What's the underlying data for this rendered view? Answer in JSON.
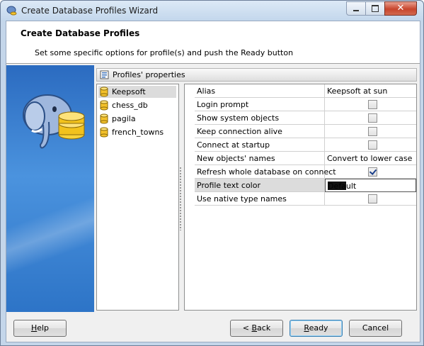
{
  "window": {
    "title": "Create Database Profiles Wizard",
    "controls": {
      "minimize_icon": "minimize-icon",
      "maximize_icon": "maximize-icon",
      "close_icon": "close-icon",
      "close_glyph": "✕"
    }
  },
  "header": {
    "title": "Create Database Profiles",
    "subtitle": "Set some specific options for profile(s) and push the Ready button"
  },
  "group": {
    "title": "Profiles' properties"
  },
  "profiles": [
    {
      "label": "Keepsoft",
      "selected": true
    },
    {
      "label": "chess_db",
      "selected": false
    },
    {
      "label": "pagila",
      "selected": false
    },
    {
      "label": "french_towns",
      "selected": false
    }
  ],
  "properties": [
    {
      "name": "Alias",
      "type": "text",
      "value": "Keepsoft at sun"
    },
    {
      "name": "Login prompt",
      "type": "checkbox",
      "checked": false
    },
    {
      "name": "Show system objects",
      "type": "checkbox",
      "checked": false
    },
    {
      "name": "Keep connection alive",
      "type": "checkbox",
      "checked": false
    },
    {
      "name": "Connect at startup",
      "type": "checkbox",
      "checked": false
    },
    {
      "name": "New objects' names",
      "type": "text",
      "value": "Convert to lower case"
    },
    {
      "name": "Refresh whole database on connect",
      "type": "checkbox",
      "checked": true
    },
    {
      "name": "Profile text color",
      "type": "color",
      "value": "Default",
      "color": "#111111",
      "selected": true
    },
    {
      "name": "Use native type names",
      "type": "checkbox",
      "checked": false
    }
  ],
  "buttons": {
    "help": {
      "pre": "",
      "mnemonic": "H",
      "post": "elp"
    },
    "back": {
      "pre": "< ",
      "mnemonic": "B",
      "post": "ack"
    },
    "ready": {
      "pre": "",
      "mnemonic": "R",
      "post": "eady"
    },
    "cancel": {
      "pre": "",
      "mnemonic": "",
      "post": "Cancel"
    }
  },
  "colors": {
    "banner": "#3a82d3",
    "selection": "#dcdcdc",
    "default_button_border": "#3c7fb1"
  }
}
